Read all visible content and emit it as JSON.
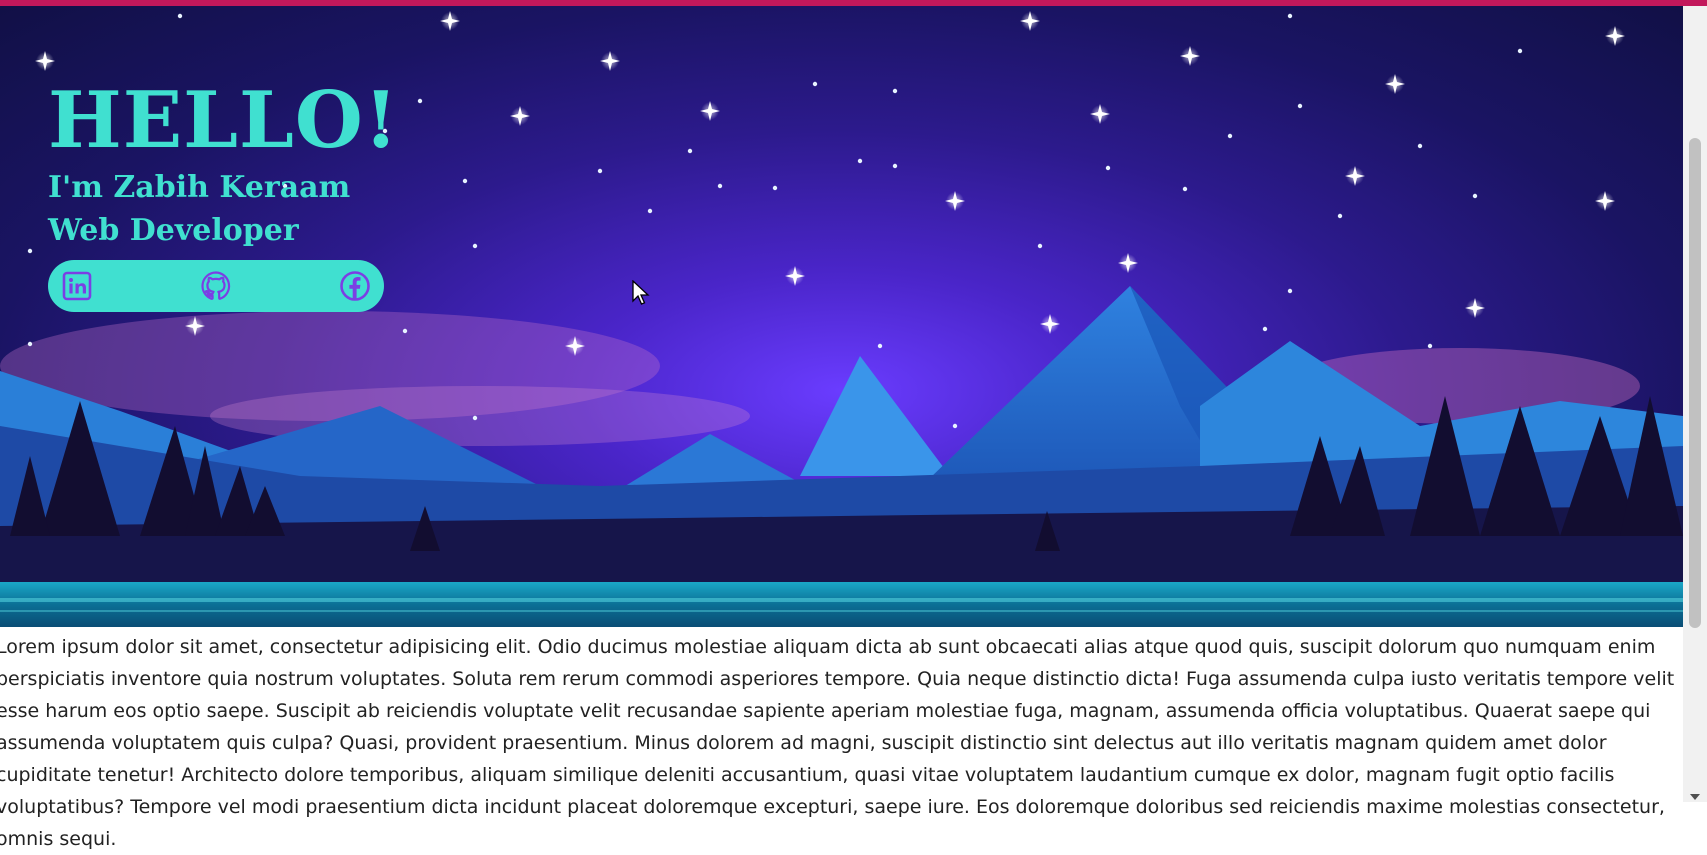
{
  "hero": {
    "greeting": "HELLO!",
    "intro_line": "I'm Zabih Keraam",
    "role_line": "Web Developer"
  },
  "social": {
    "items": [
      {
        "name": "linkedin",
        "icon": "linkedin-icon"
      },
      {
        "name": "github",
        "icon": "github-icon"
      },
      {
        "name": "facebook",
        "icon": "facebook-icon"
      }
    ]
  },
  "body_text": "Lorem ipsum dolor sit amet, consectetur adipisicing elit. Odio ducimus molestiae aliquam dicta ab sunt obcaecati alias atque quod quis, suscipit dolorum quo numquam enim perspiciatis inventore quia nostrum voluptates. Soluta rem rerum commodi asperiores tempore. Quia neque distinctio dicta! Fuga assumenda culpa iusto veritatis tempore velit esse harum eos optio saepe. Suscipit ab reiciendis voluptate velit recusandae sapiente aperiam molestiae fuga, magnam, assumenda officia voluptatibus. Quaerat saepe qui assumenda voluptatem quis culpa? Quasi, provident praesentium. Minus dolorem ad magni, suscipit distinctio sint delectus aut illo veritatis magnam quidem amet dolor cupiditate tenetur! Architecto dolore temporibus, aliquam similique deleniti accusantium, quasi vitae voluptatem laudantium cumque ex dolor, magnam fugit optio facilis voluptatibus? Tempore vel modi praesentium dicta incidunt placeat doloremque excepturi, saepe iure. Eos doloremque doloribus sed reiciendis maxime molestias consectetur, omnis sequi.",
  "colors": {
    "accent": "#40e0d0",
    "icon": "#7b3fe4",
    "top_bar": "#c2185b"
  }
}
